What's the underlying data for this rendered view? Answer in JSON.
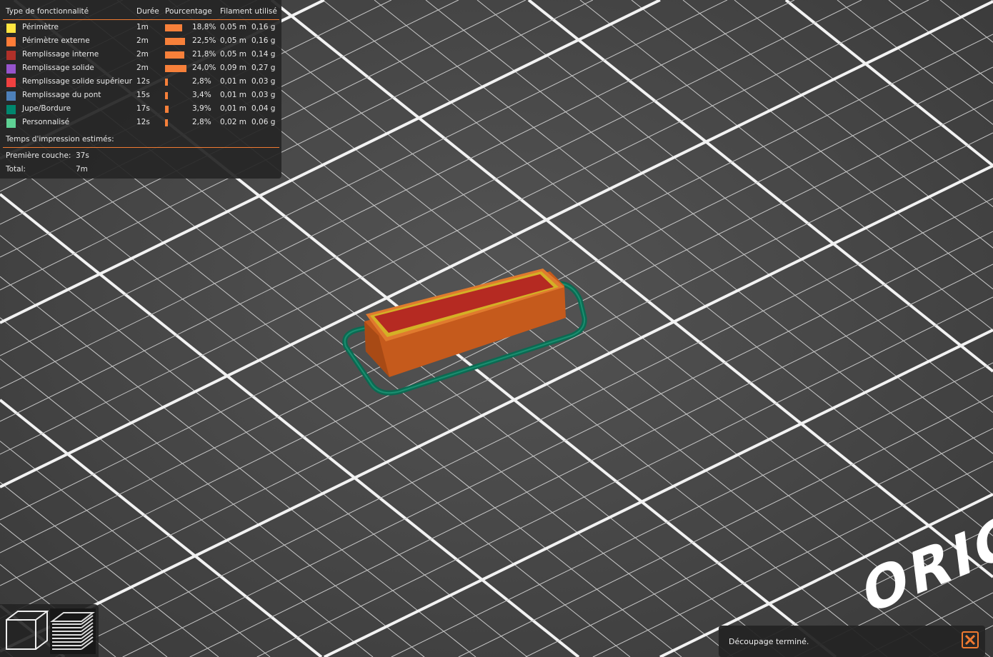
{
  "legend": {
    "headers": {
      "type": "Type de fonctionnalité",
      "duration": "Durée",
      "percentage": "Pourcentage",
      "filament": "Filament utilisé"
    },
    "rows": [
      {
        "label": "Périmètre",
        "color": "#ffe640",
        "duration": "1m",
        "percent": 18.8,
        "percent_label": "18,8%",
        "length": "0,05 m",
        "weight": "0,16 g"
      },
      {
        "label": "Périmètre externe",
        "color": "#ff7d38",
        "duration": "2m",
        "percent": 22.5,
        "percent_label": "22,5%",
        "length": "0,05 m",
        "weight": "0,16 g"
      },
      {
        "label": "Remplissage interne",
        "color": "#b03029",
        "duration": "2m",
        "percent": 21.8,
        "percent_label": "21,8%",
        "length": "0,05 m",
        "weight": "0,14 g"
      },
      {
        "label": "Remplissage solide",
        "color": "#9654cc",
        "duration": "2m",
        "percent": 24.0,
        "percent_label": "24,0%",
        "length": "0,09 m",
        "weight": "0,27 g"
      },
      {
        "label": "Remplissage solide supérieur",
        "color": "#f04040",
        "duration": "12s",
        "percent": 2.8,
        "percent_label": "2,8%",
        "length": "0,01 m",
        "weight": "0,03 g"
      },
      {
        "label": "Remplissage du pont",
        "color": "#4d80ba",
        "duration": "15s",
        "percent": 3.4,
        "percent_label": "3,4%",
        "length": "0,01 m",
        "weight": "0,03 g"
      },
      {
        "label": "Jupe/Bordure",
        "color": "#00876e",
        "duration": "17s",
        "percent": 3.9,
        "percent_label": "3,9%",
        "length": "0,01 m",
        "weight": "0,04 g"
      },
      {
        "label": "Personnalisé",
        "color": "#5ed194",
        "duration": "12s",
        "percent": 2.8,
        "percent_label": "2,8%",
        "length": "0,02 m",
        "weight": "0,06 g"
      }
    ],
    "estimated_title": "Temps d'impression estimés:",
    "first_layer_label": "Première couche:",
    "first_layer_value": "37s",
    "total_label": "Total:",
    "total_value": "7m"
  },
  "bed_logo": "ORIG",
  "toast": {
    "message": "Découpage terminé."
  },
  "accent": "#f07a30"
}
